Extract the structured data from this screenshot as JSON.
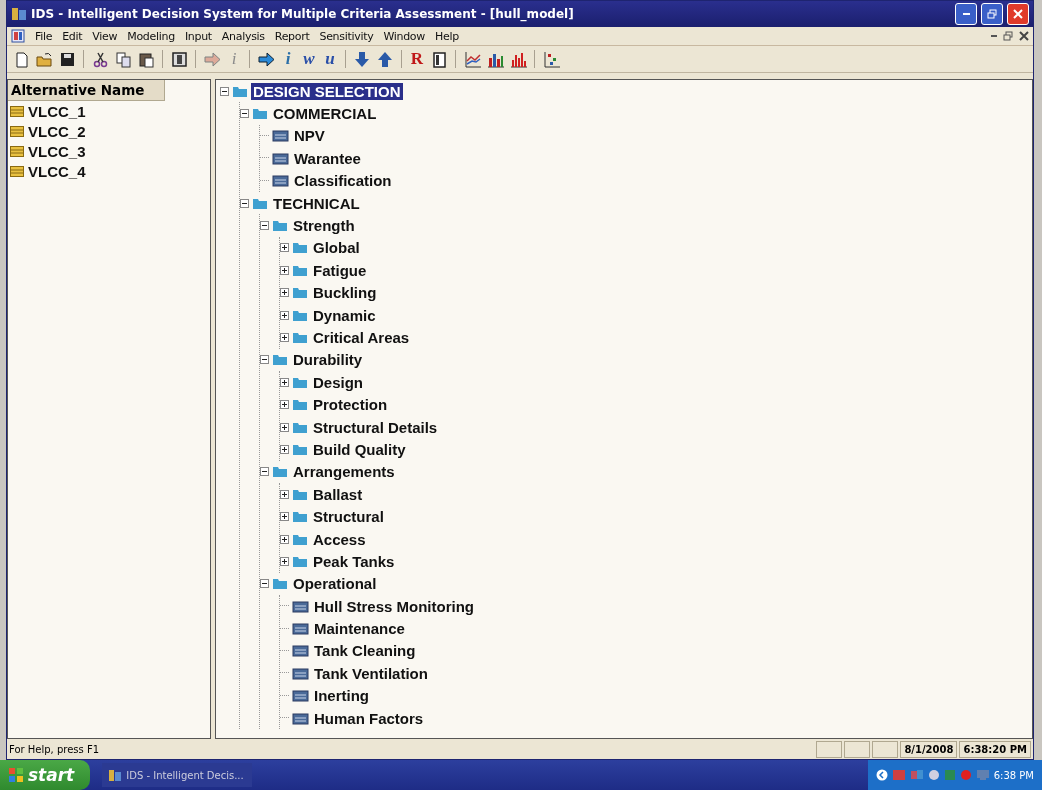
{
  "window": {
    "title": "IDS - Intelligent Decision System for Multiple Criteria Assessment - [hull_model]"
  },
  "menu": [
    "File",
    "Edit",
    "View",
    "Modeling",
    "Input",
    "Analysis",
    "Report",
    "Sensitivity",
    "Window",
    "Help"
  ],
  "toolbar": [
    {
      "kind": "new",
      "disabled": false
    },
    {
      "kind": "open",
      "disabled": false
    },
    {
      "kind": "save",
      "disabled": false
    },
    {
      "kind": "sep"
    },
    {
      "kind": "cut",
      "disabled": false
    },
    {
      "kind": "copy",
      "disabled": false
    },
    {
      "kind": "paste",
      "disabled": false
    },
    {
      "kind": "sep"
    },
    {
      "kind": "frame",
      "disabled": false
    },
    {
      "kind": "sep"
    },
    {
      "kind": "arrow",
      "disabled": true
    },
    {
      "kind": "letter",
      "label": "i",
      "color": "#8a8a8a",
      "disabled": true
    },
    {
      "kind": "sep"
    },
    {
      "kind": "arrow",
      "disabled": false
    },
    {
      "kind": "letter",
      "label": "i",
      "color": "#2a6fa8",
      "disabled": false
    },
    {
      "kind": "letter",
      "label": "w",
      "color": "#2a4fa8",
      "disabled": false
    },
    {
      "kind": "letter",
      "label": "u",
      "color": "#2a4fa8",
      "disabled": false
    },
    {
      "kind": "sep"
    },
    {
      "kind": "down",
      "disabled": false
    },
    {
      "kind": "up",
      "disabled": false
    },
    {
      "kind": "sep"
    },
    {
      "kind": "letter",
      "label": "R",
      "color": "#c01818",
      "disabled": false
    },
    {
      "kind": "doc",
      "disabled": false
    },
    {
      "kind": "sep"
    },
    {
      "kind": "linechart",
      "disabled": false
    },
    {
      "kind": "barchart",
      "disabled": false
    },
    {
      "kind": "redbars",
      "disabled": false
    },
    {
      "kind": "sep"
    },
    {
      "kind": "scatter",
      "disabled": false
    }
  ],
  "alternatives": {
    "header": "Alternative Name",
    "items": [
      "VLCC_1",
      "VLCC_2",
      "VLCC_3",
      "VLCC_4"
    ]
  },
  "tree": {
    "label": "DESIGN SELECTION",
    "kind": "folder",
    "expanded": true,
    "selected": true,
    "children": [
      {
        "label": "COMMERCIAL",
        "kind": "folder",
        "expanded": true,
        "selected": false,
        "children": [
          {
            "label": "NPV",
            "kind": "leaf",
            "selected": false
          },
          {
            "label": "Warantee",
            "kind": "leaf",
            "selected": false
          },
          {
            "label": "Classification",
            "kind": "leaf",
            "selected": false
          }
        ]
      },
      {
        "label": "TECHNICAL",
        "kind": "folder",
        "expanded": true,
        "selected": false,
        "children": [
          {
            "label": "Strength",
            "kind": "folder",
            "expanded": true,
            "selected": false,
            "children": [
              {
                "label": "Global",
                "kind": "folder",
                "expanded": false,
                "selected": false
              },
              {
                "label": "Fatigue",
                "kind": "folder",
                "expanded": false,
                "selected": false
              },
              {
                "label": "Buckling",
                "kind": "folder",
                "expanded": false,
                "selected": false
              },
              {
                "label": "Dynamic",
                "kind": "folder",
                "expanded": false,
                "selected": false
              },
              {
                "label": "Critical Areas",
                "kind": "folder",
                "expanded": false,
                "selected": false
              }
            ]
          },
          {
            "label": "Durability",
            "kind": "folder",
            "expanded": true,
            "selected": false,
            "children": [
              {
                "label": "Design",
                "kind": "folder",
                "expanded": false,
                "selected": false
              },
              {
                "label": "Protection",
                "kind": "folder",
                "expanded": false,
                "selected": false
              },
              {
                "label": "Structural Details",
                "kind": "folder",
                "expanded": false,
                "selected": false
              },
              {
                "label": "Build Quality",
                "kind": "folder",
                "expanded": false,
                "selected": false
              }
            ]
          },
          {
            "label": "Arrangements",
            "kind": "folder",
            "expanded": true,
            "selected": false,
            "children": [
              {
                "label": "Ballast",
                "kind": "folder",
                "expanded": false,
                "selected": false
              },
              {
                "label": "Structural",
                "kind": "folder",
                "expanded": false,
                "selected": false
              },
              {
                "label": "Access",
                "kind": "folder",
                "expanded": false,
                "selected": false
              },
              {
                "label": "Peak Tanks",
                "kind": "folder",
                "expanded": false,
                "selected": false
              }
            ]
          },
          {
            "label": "Operational",
            "kind": "folder",
            "expanded": true,
            "selected": false,
            "children": [
              {
                "label": "Hull Stress Monitoring",
                "kind": "leaf",
                "selected": false
              },
              {
                "label": "Maintenance",
                "kind": "leaf",
                "selected": false
              },
              {
                "label": "Tank Cleaning",
                "kind": "leaf",
                "selected": false
              },
              {
                "label": "Tank Ventilation",
                "kind": "leaf",
                "selected": false
              },
              {
                "label": "Inerting",
                "kind": "leaf",
                "selected": false
              },
              {
                "label": "Human Factors",
                "kind": "leaf",
                "selected": false
              }
            ]
          }
        ]
      }
    ]
  },
  "status_bar": {
    "text": "For Help, press F1",
    "date": "8/1/2008",
    "time": "6:38:20 PM"
  },
  "taskbar": {
    "start": "start",
    "task": "IDS - Intelligent Decis...",
    "clock": "6:38 PM"
  }
}
